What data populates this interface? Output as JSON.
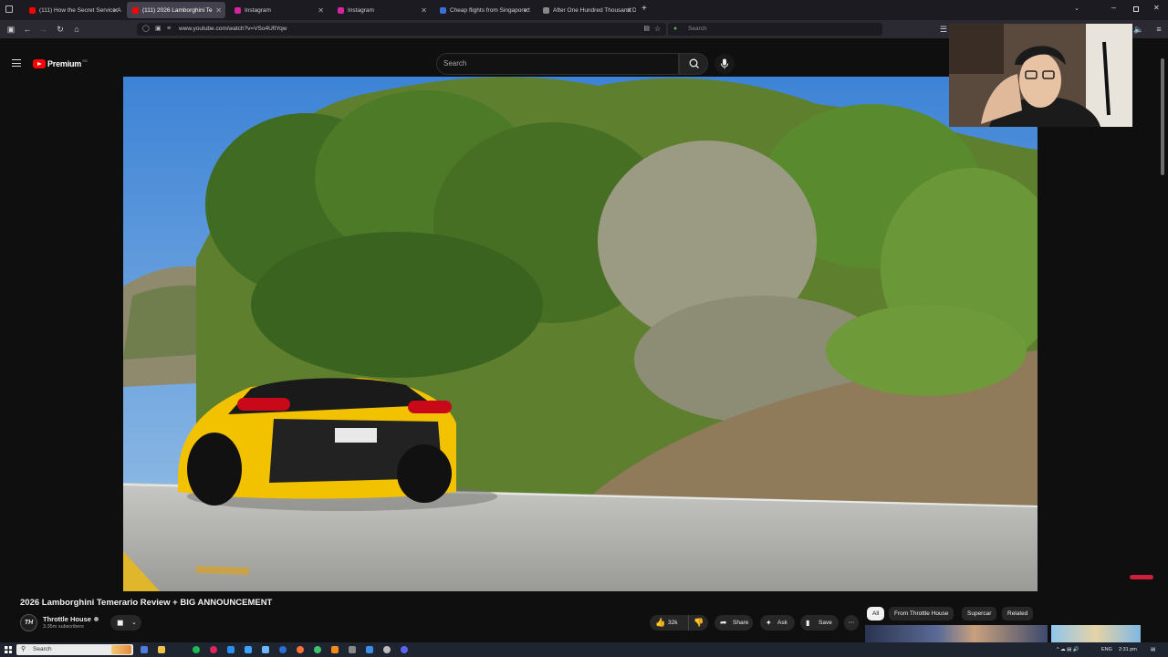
{
  "browser": {
    "tabs": [
      {
        "label": "(111) How the Secret Service A",
        "active": false,
        "favicon_color": "#ff0000"
      },
      {
        "label": "(111) 2026 Lamborghini Te",
        "active": true,
        "favicon_color": "#ff0000"
      },
      {
        "label": "Instagram",
        "active": false,
        "favicon_color": "#d6249f"
      },
      {
        "label": "Instagram",
        "active": false,
        "favicon_color": "#d6249f"
      },
      {
        "label": "Cheap flights from Singapore t",
        "active": false,
        "favicon_color": "#3a6fd8"
      },
      {
        "label": "After One Hundred Thousand D",
        "active": false,
        "favicon_color": "#888888"
      }
    ],
    "new_tab_symbol": "+",
    "url": "www.youtube.com/watch?v=VSo4UftYqw",
    "search_placeholder": "Search"
  },
  "youtube": {
    "logo_text": "Premium",
    "logo_superscript": "SG",
    "search_placeholder": "Search",
    "video": {
      "title": "2026 Lamborghini Temerario Review + BIG ANNOUNCEMENT",
      "channel_name": "Throttle House",
      "channel_initials": "TH",
      "subscribers": "3.35m subscribers",
      "likes": "32k",
      "share_label": "Share",
      "ask_label": "Ask",
      "save_label": "Save"
    },
    "chips": [
      {
        "label": "All",
        "selected": true
      },
      {
        "label": "From Throttle House",
        "selected": false
      },
      {
        "label": "Supercar",
        "selected": false
      },
      {
        "label": "Related",
        "selected": false
      }
    ]
  },
  "taskbar": {
    "search_placeholder": "Search",
    "language": "ENG",
    "time": "2:31 pm"
  },
  "colors": {
    "youtube_red": "#ff0000",
    "page_bg": "#0f0f0f",
    "car_yellow": "#f2c200"
  }
}
